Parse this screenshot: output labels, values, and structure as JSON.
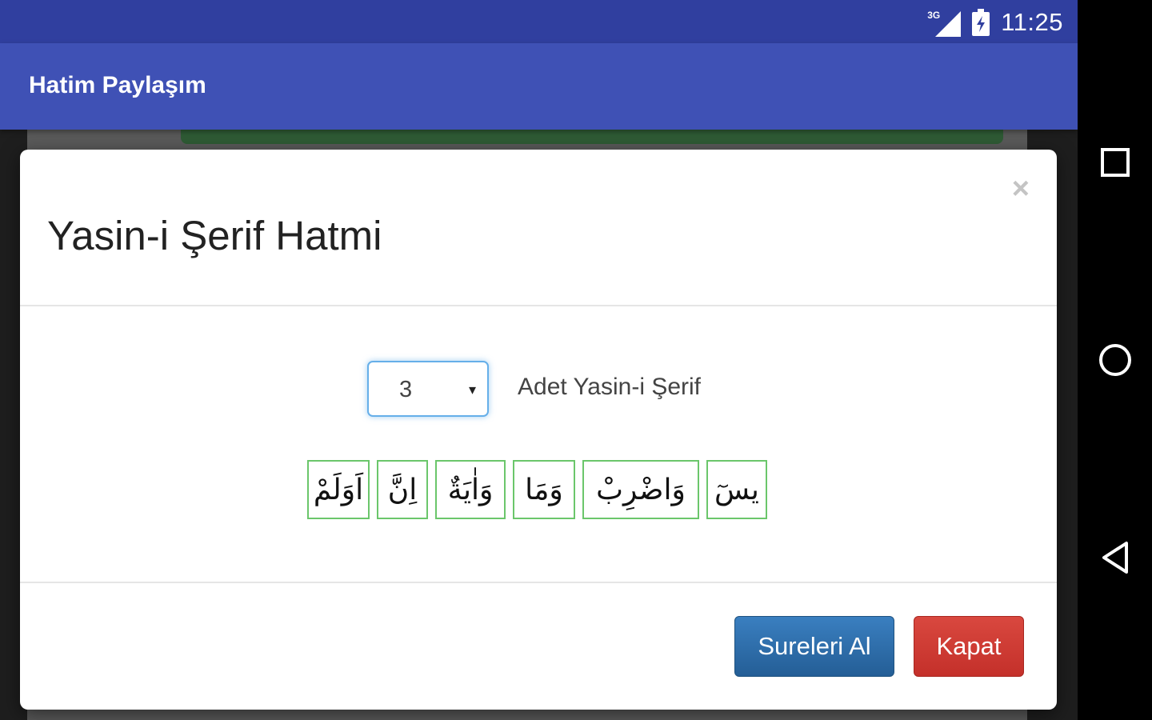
{
  "status_bar": {
    "network_label": "3G",
    "time": "11:25"
  },
  "app_bar": {
    "title": "Hatim Paylaşım"
  },
  "modal": {
    "title": "Yasin-i Şerif Hatmi",
    "close_symbol": "×",
    "count_select": {
      "value": "3",
      "caret": "▾"
    },
    "count_label": "Adet Yasin-i Şerif",
    "surah_words": [
      "يسٓ",
      "وَاضْرِبْ",
      "وَمَا",
      "وَاٰيَةٌ",
      "اِنَّ",
      "اَوَلَمْ"
    ],
    "buttons": {
      "primary": "Sureleri Al",
      "close": "Kapat"
    }
  },
  "colors": {
    "status_bar": "#303f9f",
    "app_bar": "#3f51b5",
    "primary_button": "#2a6aa8",
    "danger_button": "#d0392f",
    "surah_border": "#6bc66b"
  },
  "icons": {
    "recents": "square-icon",
    "home": "circle-icon",
    "back": "triangle-back-icon",
    "signal": "signal-icon",
    "battery": "battery-icon"
  }
}
